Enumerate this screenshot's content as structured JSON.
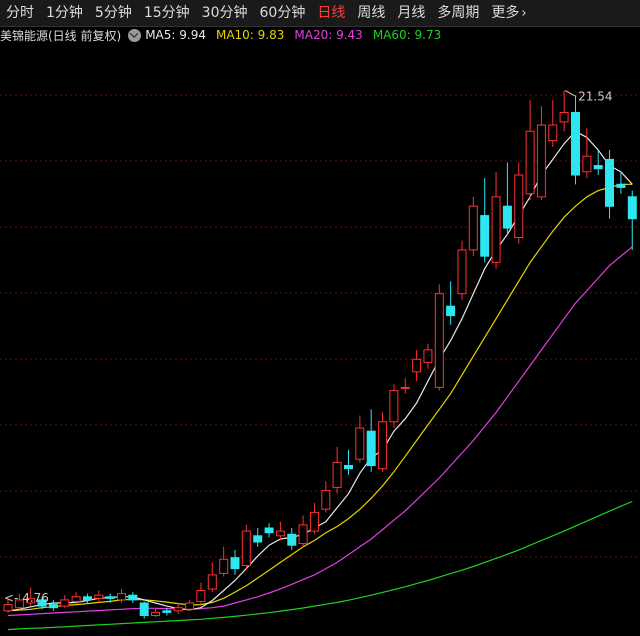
{
  "toolbar": {
    "tabs": [
      {
        "label": "分时",
        "active": false
      },
      {
        "label": "1分钟",
        "active": false
      },
      {
        "label": "5分钟",
        "active": false
      },
      {
        "label": "15分钟",
        "active": false
      },
      {
        "label": "30分钟",
        "active": false
      },
      {
        "label": "60分钟",
        "active": false
      },
      {
        "label": "日线",
        "active": true
      },
      {
        "label": "周线",
        "active": false
      },
      {
        "label": "月线",
        "active": false
      },
      {
        "label": "多周期",
        "active": false
      },
      {
        "label": "更多",
        "active": false
      }
    ]
  },
  "info": {
    "title": "美锦能源(日线 前复权)",
    "ma": [
      {
        "label": "MA5: 9.94",
        "color": "#e8e8e8"
      },
      {
        "label": "MA10: 9.83",
        "color": "#e6d300"
      },
      {
        "label": "MA20: 9.43",
        "color": "#e040e0"
      },
      {
        "label": "MA60: 9.73",
        "color": "#20d020"
      }
    ]
  },
  "colors": {
    "up": "#ff3030",
    "down": "#2ee6f0",
    "grid": "#6a1010"
  },
  "chart_data": {
    "type": "candlestick",
    "high_label": "21.54",
    "low_label": "4.76",
    "ylim": [
      4.3,
      22.8
    ],
    "candles": [
      [
        4.85,
        5.05,
        4.78,
        5.2
      ],
      [
        4.95,
        5.2,
        4.85,
        5.4
      ],
      [
        5.1,
        5.25,
        5.0,
        5.6
      ],
      [
        5.2,
        5.0,
        4.9,
        5.3
      ],
      [
        5.05,
        4.95,
        4.85,
        5.2
      ],
      [
        5.0,
        5.2,
        4.95,
        5.35
      ],
      [
        5.15,
        5.3,
        5.05,
        5.45
      ],
      [
        5.3,
        5.2,
        5.1,
        5.4
      ],
      [
        5.25,
        5.35,
        5.15,
        5.5
      ],
      [
        5.3,
        5.25,
        5.1,
        5.4
      ],
      [
        5.2,
        5.4,
        5.1,
        5.55
      ],
      [
        5.35,
        5.2,
        5.1,
        5.45
      ],
      [
        5.1,
        4.7,
        4.6,
        5.15
      ],
      [
        4.7,
        4.8,
        4.65,
        4.95
      ],
      [
        4.85,
        4.8,
        4.7,
        4.95
      ],
      [
        4.85,
        4.95,
        4.75,
        5.1
      ],
      [
        4.9,
        5.1,
        4.85,
        5.2
      ],
      [
        5.15,
        5.5,
        5.05,
        5.75
      ],
      [
        5.55,
        6.0,
        5.45,
        6.4
      ],
      [
        6.05,
        6.5,
        5.95,
        6.9
      ],
      [
        6.55,
        6.2,
        6.0,
        6.8
      ],
      [
        6.3,
        7.4,
        6.2,
        7.6
      ],
      [
        7.25,
        7.05,
        6.9,
        7.5
      ],
      [
        7.5,
        7.35,
        7.2,
        7.65
      ],
      [
        7.25,
        7.4,
        7.1,
        7.7
      ],
      [
        7.3,
        6.95,
        6.8,
        7.5
      ],
      [
        7.0,
        7.6,
        6.9,
        7.9
      ],
      [
        7.4,
        8.0,
        7.3,
        8.3
      ],
      [
        8.1,
        8.7,
        8.0,
        9.0
      ],
      [
        8.8,
        9.6,
        8.6,
        10.1
      ],
      [
        9.5,
        9.4,
        9.2,
        10.0
      ],
      [
        9.7,
        10.7,
        9.6,
        11.1
      ],
      [
        10.6,
        9.5,
        9.3,
        11.3
      ],
      [
        9.4,
        10.9,
        9.3,
        11.2
      ],
      [
        10.9,
        11.9,
        10.7,
        12.1
      ],
      [
        12.0,
        12.0,
        11.8,
        12.3
      ],
      [
        12.5,
        12.9,
        12.2,
        13.2
      ],
      [
        12.8,
        13.2,
        12.6,
        13.4
      ],
      [
        12.0,
        15.0,
        11.9,
        15.3
      ],
      [
        14.6,
        14.3,
        14.0,
        15.4
      ],
      [
        15.0,
        16.4,
        14.8,
        16.7
      ],
      [
        16.4,
        17.8,
        16.2,
        18.1
      ],
      [
        17.5,
        16.2,
        16.0,
        18.7
      ],
      [
        16.0,
        18.1,
        15.8,
        18.9
      ],
      [
        17.8,
        17.1,
        16.9,
        19.2
      ],
      [
        16.8,
        18.8,
        16.6,
        19.2
      ],
      [
        18.2,
        20.2,
        18.0,
        21.2
      ],
      [
        18.1,
        20.4,
        18.0,
        21.0
      ],
      [
        19.9,
        20.4,
        19.7,
        21.2
      ],
      [
        20.5,
        20.8,
        20.2,
        21.5
      ],
      [
        20.8,
        18.8,
        18.5,
        21.3
      ],
      [
        18.9,
        19.4,
        18.7,
        20.3
      ],
      [
        19.1,
        19.0,
        18.8,
        19.6
      ],
      [
        19.3,
        17.8,
        17.4,
        19.6
      ],
      [
        18.5,
        18.4,
        18.2,
        18.9
      ],
      [
        18.1,
        17.4,
        16.4,
        18.3
      ]
    ],
    "ma5": [
      4.85,
      4.9,
      4.98,
      5.05,
      5.1,
      5.1,
      5.12,
      5.18,
      5.25,
      5.28,
      5.3,
      5.3,
      5.2,
      5.1,
      5.0,
      4.92,
      4.88,
      4.95,
      5.18,
      5.5,
      5.82,
      6.2,
      6.6,
      6.95,
      7.15,
      7.2,
      7.3,
      7.5,
      7.7,
      8.15,
      8.6,
      9.25,
      9.75,
      10.0,
      10.6,
      11.0,
      11.5,
      12.2,
      12.9,
      13.5,
      14.2,
      15.0,
      15.8,
      16.4,
      16.9,
      17.5,
      18.1,
      18.8,
      19.3,
      19.8,
      20.2,
      20.0,
      19.6,
      19.1,
      18.9,
      18.5
    ],
    "ma10": [
      4.85,
      4.87,
      4.9,
      4.95,
      4.98,
      5.02,
      5.05,
      5.08,
      5.12,
      5.15,
      5.2,
      5.22,
      5.2,
      5.17,
      5.13,
      5.08,
      5.04,
      5.05,
      5.12,
      5.25,
      5.45,
      5.65,
      5.9,
      6.15,
      6.4,
      6.65,
      6.9,
      7.1,
      7.35,
      7.55,
      7.8,
      8.1,
      8.45,
      8.85,
      9.3,
      9.8,
      10.3,
      10.8,
      11.3,
      11.8,
      12.4,
      13.0,
      13.6,
      14.2,
      14.8,
      15.4,
      16.0,
      16.5,
      17.0,
      17.45,
      17.8,
      18.1,
      18.3,
      18.4,
      18.5,
      18.5
    ],
    "ma20": [
      4.7,
      4.72,
      4.74,
      4.76,
      4.78,
      4.8,
      4.82,
      4.84,
      4.86,
      4.88,
      4.9,
      4.92,
      4.93,
      4.93,
      4.92,
      4.91,
      4.9,
      4.92,
      4.95,
      5.0,
      5.1,
      5.2,
      5.3,
      5.42,
      5.55,
      5.7,
      5.85,
      6.0,
      6.2,
      6.4,
      6.65,
      6.9,
      7.15,
      7.45,
      7.75,
      8.05,
      8.4,
      8.75,
      9.1,
      9.5,
      9.9,
      10.3,
      10.75,
      11.2,
      11.7,
      12.2,
      12.7,
      13.2,
      13.7,
      14.2,
      14.7,
      15.1,
      15.5,
      15.9,
      16.2,
      16.5
    ],
    "ma60": [
      4.25,
      4.27,
      4.29,
      4.3,
      4.32,
      4.34,
      4.36,
      4.38,
      4.4,
      4.42,
      4.44,
      4.46,
      4.48,
      4.5,
      4.52,
      4.54,
      4.56,
      4.58,
      4.61,
      4.64,
      4.67,
      4.71,
      4.75,
      4.79,
      4.84,
      4.89,
      4.94,
      5.0,
      5.06,
      5.12,
      5.19,
      5.27,
      5.35,
      5.44,
      5.53,
      5.62,
      5.72,
      5.82,
      5.93,
      6.04,
      6.15,
      6.27,
      6.4,
      6.53,
      6.66,
      6.8,
      6.95,
      7.1,
      7.25,
      7.4,
      7.56,
      7.72,
      7.88,
      8.04,
      8.2,
      8.35
    ]
  }
}
